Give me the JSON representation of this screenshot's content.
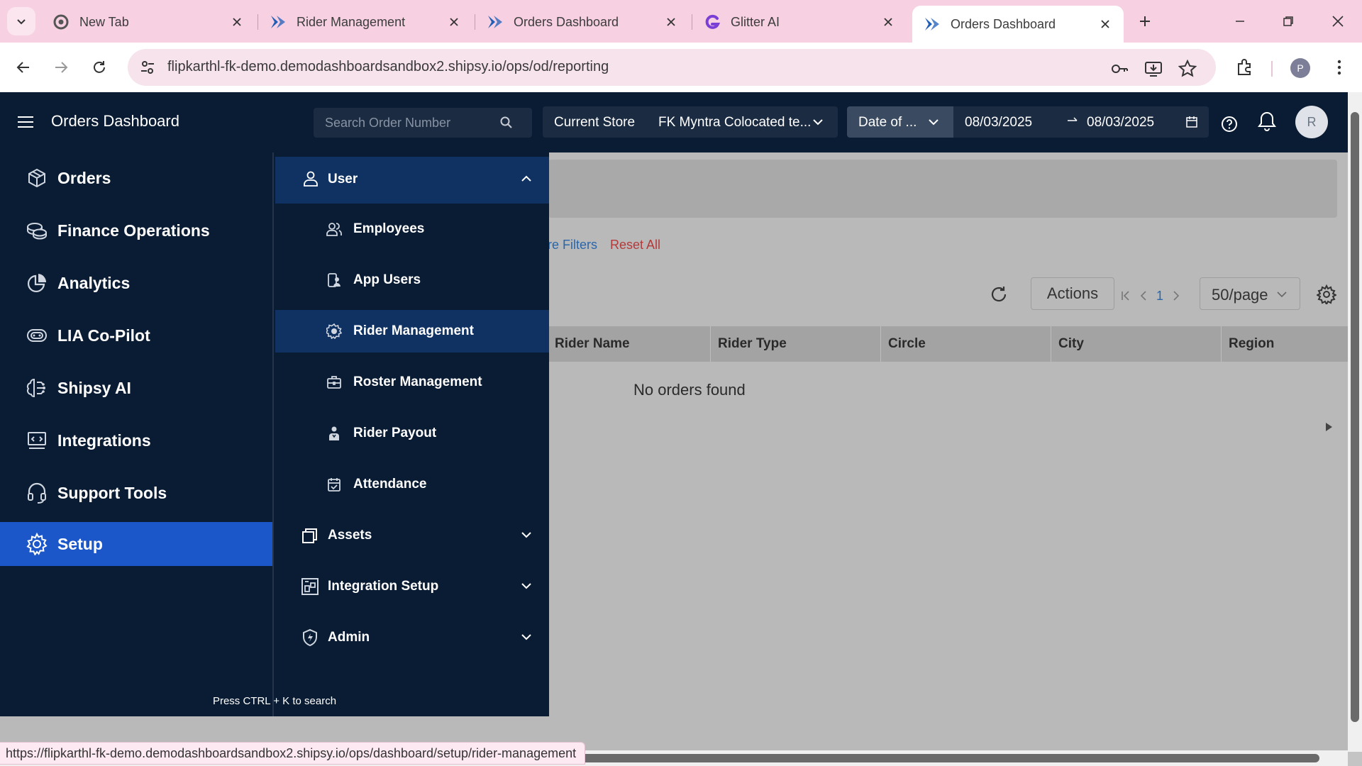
{
  "browser": {
    "tabs": [
      {
        "title": "New Tab",
        "icon": "chrome-icon"
      },
      {
        "title": "Rider Management",
        "icon": "shipsy-icon"
      },
      {
        "title": "Orders Dashboard",
        "icon": "shipsy-icon"
      },
      {
        "title": "Glitter AI",
        "icon": "glitter-icon"
      },
      {
        "title": "Orders Dashboard",
        "icon": "shipsy-icon",
        "active": true
      }
    ],
    "url": "flipkarthl-fk-demo.demodashboardsandbox2.shipsy.io/ops/od/reporting",
    "profile_initial": "P",
    "status_url": "https://flipkarthl-fk-demo.demodashboardsandbox2.shipsy.io/ops/dashboard/setup/rider-management"
  },
  "header": {
    "title": "Orders Dashboard",
    "search_placeholder": "Search Order Number",
    "store_label": "Current Store",
    "store_value": "FK Myntra Colocated te...",
    "date_type": "Date of ...",
    "date_from": "08/03/2025",
    "date_to": "08/03/2025",
    "avatar_initial": "R"
  },
  "sidebar": {
    "items": [
      {
        "label": "Orders",
        "icon": "box-icon"
      },
      {
        "label": "Finance Operations",
        "icon": "coins-icon"
      },
      {
        "label": "Analytics",
        "icon": "pie-chart-icon"
      },
      {
        "label": "LIA Co-Pilot",
        "icon": "copilot-icon"
      },
      {
        "label": "Shipsy AI",
        "icon": "ai-brain-icon"
      },
      {
        "label": "Integrations",
        "icon": "integrations-icon"
      },
      {
        "label": "Support Tools",
        "icon": "headset-icon"
      },
      {
        "label": "Setup",
        "icon": "gear-icon",
        "active": true
      }
    ],
    "shortcut_hint": "Press CTRL + K to search"
  },
  "submenu": {
    "user_label": "User",
    "user_items": [
      {
        "label": "Employees",
        "icon": "employees-icon"
      },
      {
        "label": "App Users",
        "icon": "app-users-icon"
      },
      {
        "label": "Rider Management",
        "icon": "rider-icon",
        "active": true
      },
      {
        "label": "Roster Management",
        "icon": "roster-icon"
      },
      {
        "label": "Rider Payout",
        "icon": "payout-icon"
      },
      {
        "label": "Attendance",
        "icon": "attendance-icon"
      }
    ],
    "groups": [
      {
        "label": "Assets",
        "icon": "assets-icon"
      },
      {
        "label": "Integration Setup",
        "icon": "integration-setup-icon"
      },
      {
        "label": "Admin",
        "icon": "admin-shield-icon"
      }
    ]
  },
  "content": {
    "more_filters": "re Filters",
    "reset_all": "Reset All",
    "actions_label": "Actions",
    "page_number": "1",
    "per_page": "50/page",
    "columns": [
      "Rider Name",
      "Rider Type",
      "Circle",
      "City",
      "Region"
    ],
    "empty_text": "No orders found"
  },
  "colors": {
    "nav_bg": "#0a1c33",
    "active_blue": "#1b57c9",
    "submenu_active": "#0f3263",
    "tabbar_pink": "#f7d0e2"
  }
}
